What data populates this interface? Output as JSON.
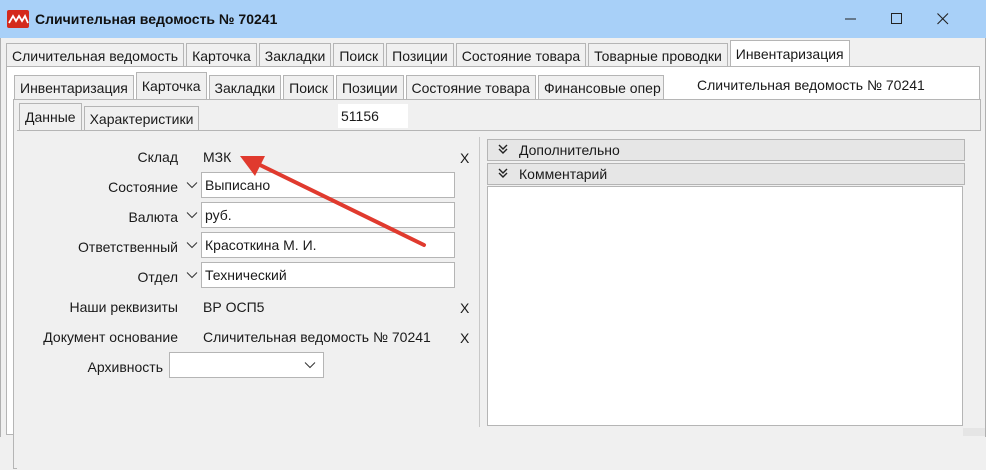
{
  "window": {
    "title": "Сличительная ведомость № 70241",
    "icons": {
      "app": "app-logo-icon",
      "minimize": "minimize-icon",
      "maximize": "maximize-icon",
      "close": "close-icon"
    }
  },
  "outer_tabs": [
    {
      "label": "Сличительная ведомость",
      "active": false
    },
    {
      "label": "Карточка",
      "active": false
    },
    {
      "label": "Закладки",
      "active": false
    },
    {
      "label": "Поиск",
      "active": false
    },
    {
      "label": "Позиции",
      "active": false
    },
    {
      "label": "Состояние товара",
      "active": false
    },
    {
      "label": "Товарные проводки",
      "active": false
    },
    {
      "label": "Инвентаризация",
      "active": true
    }
  ],
  "inner_tabs": [
    {
      "label": "Инвентаризация",
      "active": false
    },
    {
      "label": "Карточка",
      "active": true
    },
    {
      "label": "Закладки",
      "active": false
    },
    {
      "label": "Поиск",
      "active": false
    },
    {
      "label": "Позиции",
      "active": false
    },
    {
      "label": "Состояние товара",
      "active": false
    },
    {
      "label": "Финансовые опер",
      "active": false
    }
  ],
  "inner_doc_title": "Сличительная ведомость № 70241",
  "sub_tabs": [
    {
      "label": "Данные",
      "active": true
    },
    {
      "label": "Характеристики",
      "active": false
    }
  ],
  "doc_number": "51156",
  "form": {
    "warehouse": {
      "label": "Склад",
      "value": "МЗК",
      "clear": "X"
    },
    "state": {
      "label": "Состояние",
      "value": "Выписано"
    },
    "currency": {
      "label": "Валюта",
      "value": "руб."
    },
    "responsible": {
      "label": "Ответственный",
      "value": "Красоткина М. И."
    },
    "department": {
      "label": "Отдел",
      "value": "Технический"
    },
    "our_details": {
      "label": "Наши реквизиты",
      "value": "ВР ОСП5",
      "clear": "X"
    },
    "base_document": {
      "label": "Документ основание",
      "value": "Сличительная ведомость № 70241",
      "clear": "X"
    },
    "archive": {
      "label": "Архивность",
      "value": ""
    }
  },
  "right_panel": {
    "additional": "Дополнительно",
    "comment": "Комментарий"
  },
  "annotation": {
    "color": "#e03a2e"
  }
}
